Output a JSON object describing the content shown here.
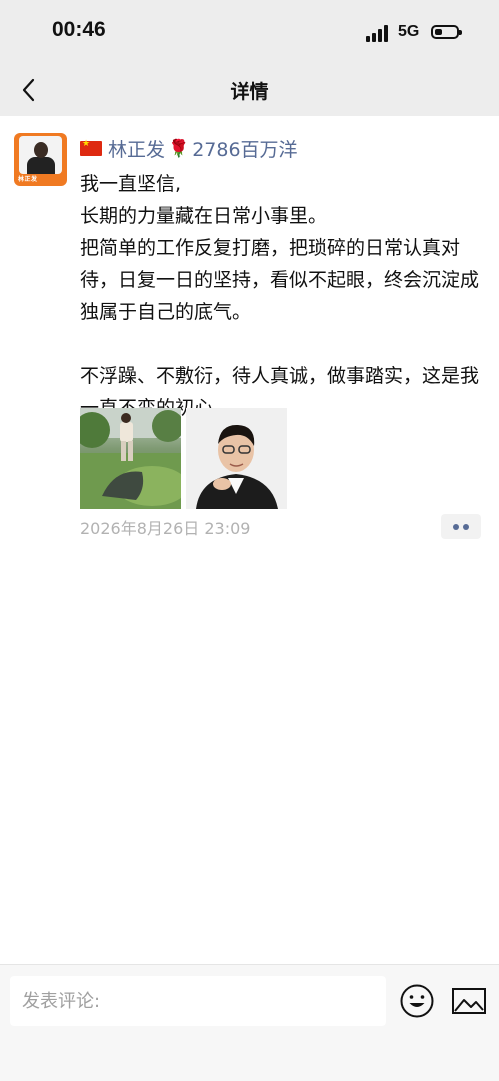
{
  "status_bar": {
    "time": "00:46",
    "network": "5G"
  },
  "nav": {
    "title": "详情",
    "back_icon": "chevron-left-icon"
  },
  "post": {
    "author": {
      "name": "林正发",
      "suffix": "2786百万洋",
      "avatar_label": "林正发"
    },
    "lines": [
      "我一直坚信,",
      "长期的力量藏在日常小事里。",
      "把简单的工作反复打磨，把琐碎的日常认真对待，日复一日的坚持，看似不起眼，终会沉淀成独属于自己的底气。",
      "",
      "不浮躁、不敷衍，待人真诚，做事踏实，这是我一直不变的初心。"
    ],
    "timestamp": "2026年8月26日 23:09"
  },
  "comment": {
    "placeholder": "发表评论:"
  },
  "colors": {
    "link": "#576b95",
    "bar_bg": "#ededed",
    "avatar_bg": "#f07a22"
  }
}
